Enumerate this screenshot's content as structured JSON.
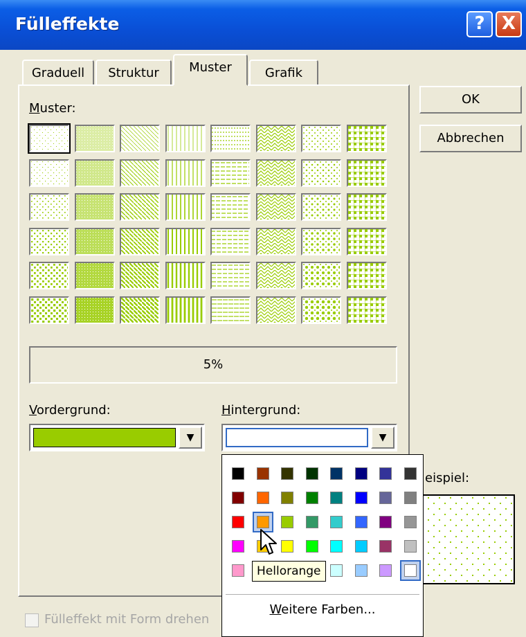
{
  "window": {
    "title": "Fülleffekte"
  },
  "titlebar": {
    "help_label": "?",
    "close_label": "X"
  },
  "tabs": [
    {
      "label": "Graduell",
      "active": false
    },
    {
      "label": "Struktur",
      "active": false
    },
    {
      "label": "Muster",
      "active": true
    },
    {
      "label": "Grafik",
      "active": false
    }
  ],
  "muster": {
    "label_accel": "M",
    "label_rest": "uster:",
    "selected_description": "5%",
    "foreground_color": "#99cc00",
    "background_color": "#ffffff"
  },
  "vordergrund": {
    "label_accel": "V",
    "label_rest": "ordergrund:",
    "color": "#99cc00"
  },
  "hintergrund": {
    "label_accel": "H",
    "label_rest": "intergrund:",
    "color": "#ffffff"
  },
  "buttons": {
    "ok": "OK",
    "cancel": "Abbrechen"
  },
  "beispiel": {
    "label_visible": "eispiel:"
  },
  "color_popup": {
    "colors": [
      [
        "#000000",
        "#993300",
        "#333300",
        "#003300",
        "#003366",
        "#000080",
        "#333399",
        "#333333"
      ],
      [
        "#800000",
        "#ff6600",
        "#808000",
        "#008000",
        "#008080",
        "#0000ff",
        "#666699",
        "#808080"
      ],
      [
        "#ff0000",
        "#ff9900",
        "#99cc00",
        "#339966",
        "#33cccc",
        "#3366ff",
        "#800080",
        "#969696"
      ],
      [
        "#ff00ff",
        "#ffcc00",
        "#ffff00",
        "#00ff00",
        "#00ffff",
        "#00ccff",
        "#993366",
        "#c0c0c0"
      ],
      [
        "#ff99cc",
        "#ffcc99",
        "#ffff99",
        "#ccffcc",
        "#ccffff",
        "#99ccff",
        "#cc99ff",
        "#ffffff"
      ]
    ],
    "hovered": {
      "row": 2,
      "col": 1
    },
    "selected": {
      "row": 4,
      "col": 7
    },
    "tooltip": "Hellorange",
    "more_accel": "W",
    "more_rest": "eitere Farben..."
  },
  "checkbox": {
    "label": "Fülleffekt mit Form drehen",
    "checked": false,
    "enabled": false
  }
}
